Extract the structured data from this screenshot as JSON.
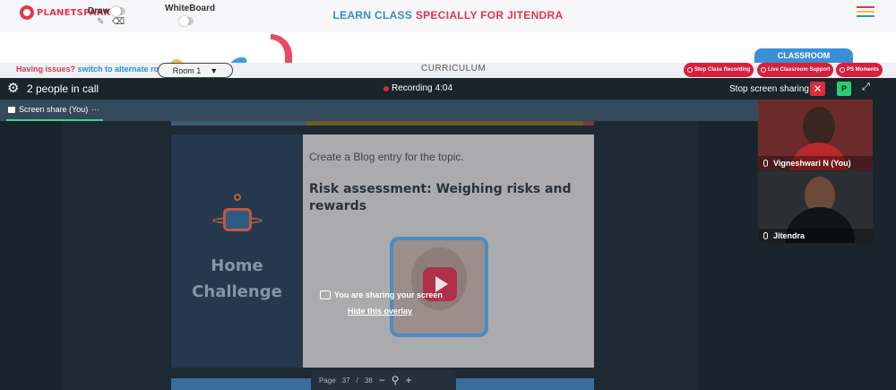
{
  "header": {
    "logo_text": "PLANETSPARK",
    "draw_label": "Draw",
    "whiteboard_label": "WhiteBoard",
    "title_part1": "LEARN CLASS",
    "title_part2": "SPECIALLY FOR JITENDRA",
    "hamburger_colors": [
      "#e2374e",
      "#f5c22b",
      "#2e8fd3"
    ]
  },
  "tabs": {
    "classroom": "CLASSROOM",
    "curriculum": "CURRICULUM"
  },
  "infostrip": {
    "issues_text": "Having issues?",
    "switch_link": "switch to alternate room",
    "room_value": "Room 1",
    "buttons": {
      "stop_recording": "Stop Class Recording",
      "live_support": "Live Classroom Support",
      "ps_moments": "PS Moments"
    }
  },
  "call": {
    "people_count": "2 people in call",
    "recording_label": "Recording",
    "recording_time": "4:04",
    "stop_sharing": "Stop screen sharing",
    "close_symbol": "✕",
    "avatar_letter": "P",
    "screen_share_tab": "Screen share (You)",
    "tab_more": "···"
  },
  "slide": {
    "side_title_1": "Home",
    "side_title_2": "Challenge",
    "prompt": "Create a Blog entry for the topic.",
    "topic": "Risk assessment: Weighing risks and rewards",
    "overlay_message": "You are sharing your screen",
    "hide_overlay": "Hide this overlay"
  },
  "pager": {
    "label": "Page",
    "current": "37",
    "separator": "/",
    "total": "38",
    "zoom_out": "−",
    "zoom_icon": "⚲",
    "zoom_in": "+"
  },
  "participants": [
    {
      "name": "Vigneshwari N (You)"
    },
    {
      "name": "Jitendra"
    }
  ],
  "colors": {
    "brand_red": "#e2374e",
    "brand_blue": "#2e8fd3",
    "call_bg": "#1d2a33",
    "share_accent": "#3ad39a"
  }
}
